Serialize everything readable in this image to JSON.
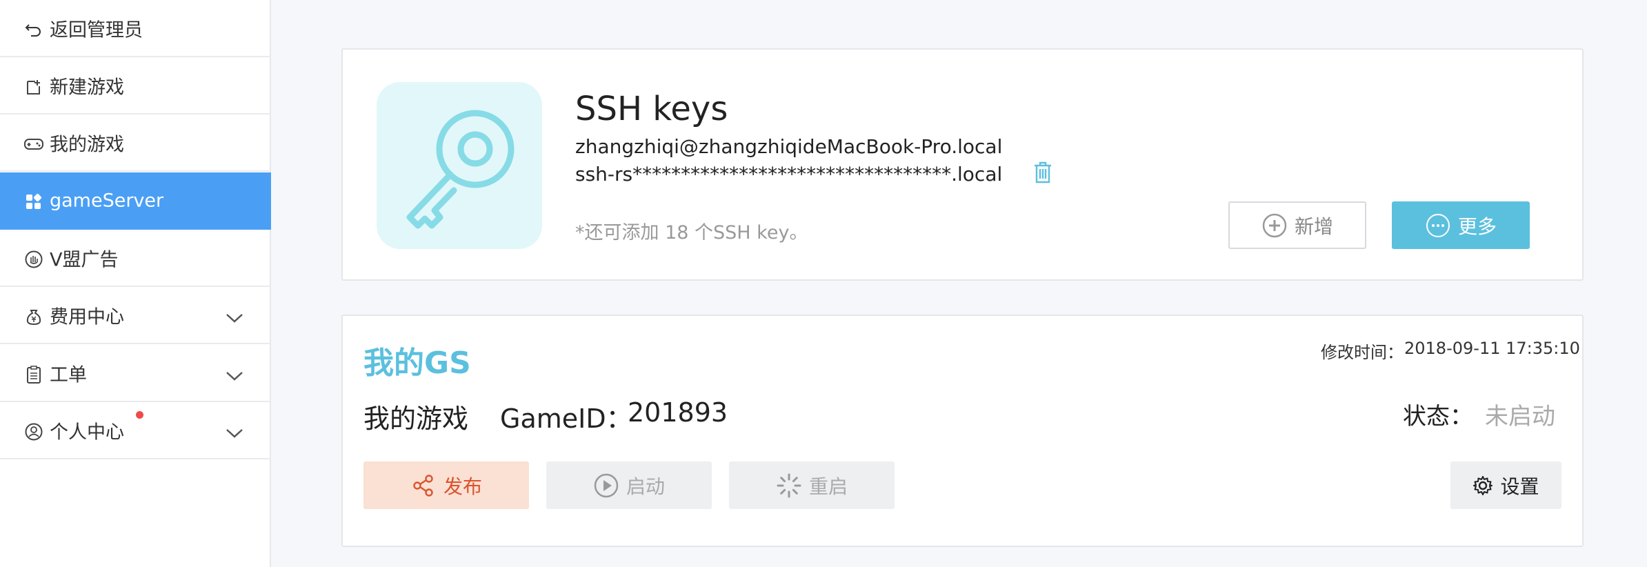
{
  "sidebar": {
    "items": [
      {
        "label": "返回管理员",
        "icon": "back-arrow-icon"
      },
      {
        "label": "新建游戏",
        "icon": "new-file-icon"
      },
      {
        "label": "我的游戏",
        "icon": "gamepad-icon"
      },
      {
        "label": "gameServer",
        "icon": "grid-blocks-icon"
      },
      {
        "label": "V盟广告",
        "icon": "hand-badge-icon"
      },
      {
        "label": "费用中心",
        "icon": "money-bag-icon"
      },
      {
        "label": "工单",
        "icon": "clipboard-icon"
      },
      {
        "label": "个人中心",
        "icon": "user-circle-icon"
      }
    ]
  },
  "ssh": {
    "title": "SSH keys",
    "email": "zhangzhiqi@zhangzhiqideMacBook-Pro.local",
    "key": "ssh-rs*********************************.local",
    "note": "*还可添加 18 个SSH key。",
    "add_label": "新增",
    "more_label": "更多"
  },
  "gs": {
    "title": "我的GS",
    "mtime_label": "修改时间：",
    "mtime": "2018-09-11 17:35:10",
    "game_name": "我的游戏",
    "game_id_label": "GameID：",
    "game_id": "201893",
    "status_label": "状态：",
    "status": "未启动",
    "publish_label": "发布",
    "start_label": "启动",
    "restart_label": "重启",
    "settings_label": "设置"
  },
  "colors": {
    "accent": "#4a9ff5",
    "info": "#5bc0de",
    "publish_bg": "#fbe0d4",
    "publish_fg": "#d9542d",
    "notice_dot": "#f04a4a"
  }
}
